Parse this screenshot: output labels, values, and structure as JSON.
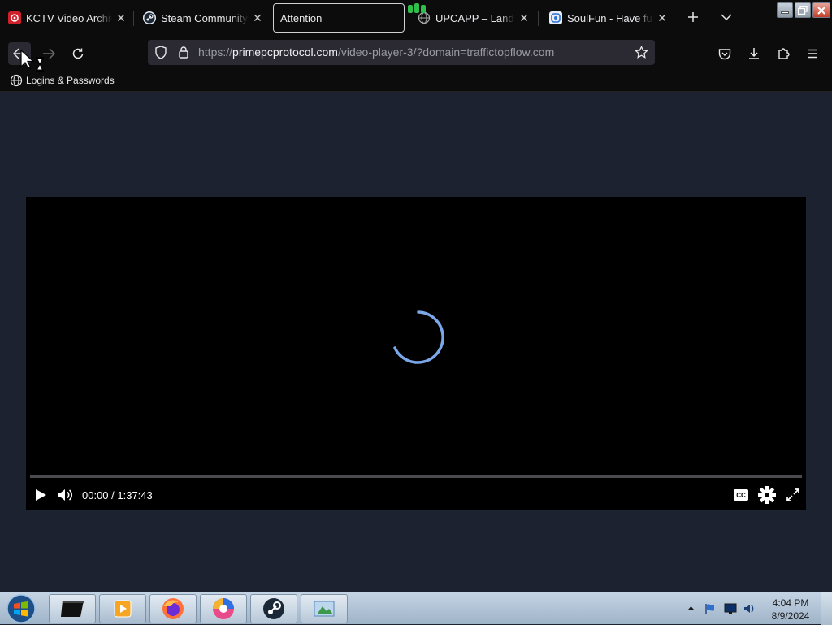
{
  "browser": {
    "tabs": [
      {
        "title": "KCTV Video Archive",
        "favicon": "kctv-favicon",
        "color": "#d0202a",
        "active": false
      },
      {
        "title": "Steam Community ::",
        "favicon": "steam-favicon",
        "color": "#1b2838",
        "active": false
      },
      {
        "title": "Attention",
        "favicon": "",
        "color": "",
        "active": true
      },
      {
        "title": "UPCAPP – Landings",
        "favicon": "globe-favicon",
        "color": "#888888",
        "active": false
      },
      {
        "title": "SoulFun - Have fun w",
        "favicon": "soulfun-favicon",
        "color": "#2e6fd8",
        "active": false
      }
    ],
    "url_prefix": "https://",
    "url_host": "primepcprotocol.com",
    "url_path": "/video-player-3/?domain=traffictopflow.com",
    "bookmark": "Logins & Passwords"
  },
  "player": {
    "state": "loading",
    "current_time": "00:00",
    "duration": "1:37:43",
    "time_display": "00:00 / 1:37:43",
    "progress": 0,
    "cc_label": "CC",
    "spinner_color": "#7aa7e8"
  },
  "taskbar": {
    "apps": [
      "command-prompt",
      "media-player",
      "firefox",
      "browser-swirl",
      "steam",
      "image-viewer"
    ],
    "clock_time": "4:04 PM",
    "clock_date": "8/9/2024"
  },
  "colors": {
    "page_bg": "#1c2230",
    "chrome_bg": "#0c0c0d",
    "player_bg": "#000000"
  }
}
